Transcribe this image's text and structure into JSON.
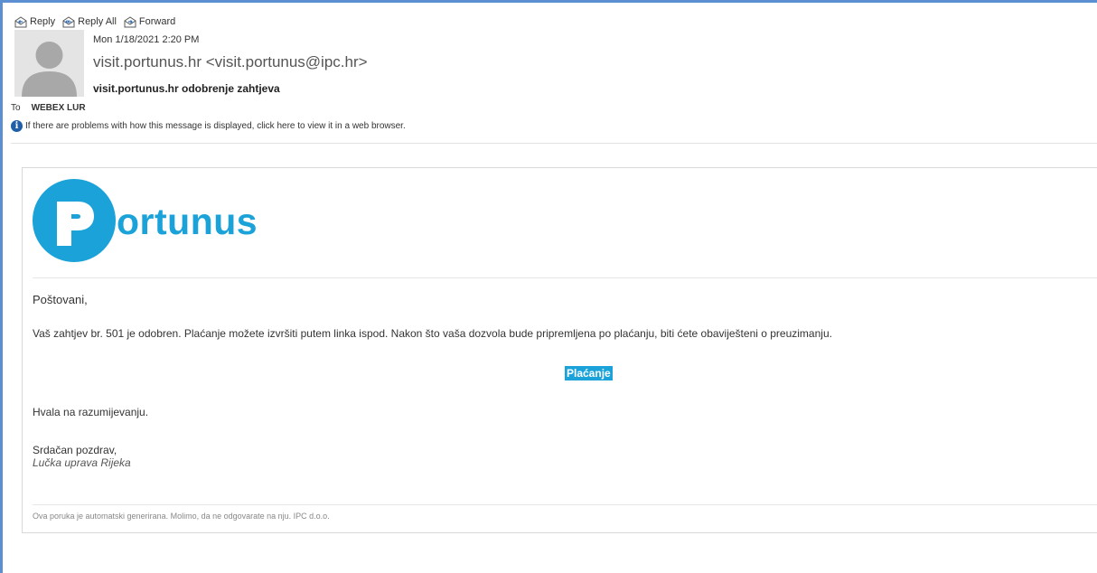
{
  "actions": {
    "reply": "Reply",
    "reply_all": "Reply All",
    "forward": "Forward"
  },
  "header": {
    "date": "Mon 1/18/2021 2:20 PM",
    "from": "visit.portunus.hr <visit.portunus@ipc.hr>",
    "subject": "visit.portunus.hr odobrenje zahtjeva",
    "to_label": "To",
    "to_value": "WEBEX LUR",
    "info_message": "If there are problems with how this message is displayed, click here to view it in a web browser."
  },
  "email": {
    "logo_text": "ortunus",
    "greeting": "Poštovani,",
    "body": "Vaš zahtjev br. 501 je odobren. Plaćanje možete izvršiti putem linka ispod. Nakon što vaša dozvola bude pripremljena po plaćanju, biti ćete obaviješteni o preuzimanju.",
    "pay_link": "Plaćanje",
    "thanks": "Hvala na razumijevanju.",
    "regards": "Srdačan pozdrav,",
    "signature": "Lučka uprava Rijeka",
    "footer": "Ova poruka je automatski generirana. Molimo, da ne odgovarate na nju. IPC d.o.o."
  },
  "colors": {
    "brand": "#1ba3d9",
    "frame": "#5b8fd1",
    "info_icon": "#1f5fa8"
  },
  "icons": {
    "reply": "reply-icon",
    "reply_all": "reply-all-icon",
    "forward": "forward-icon",
    "info": "info-icon",
    "avatar": "person-silhouette"
  }
}
